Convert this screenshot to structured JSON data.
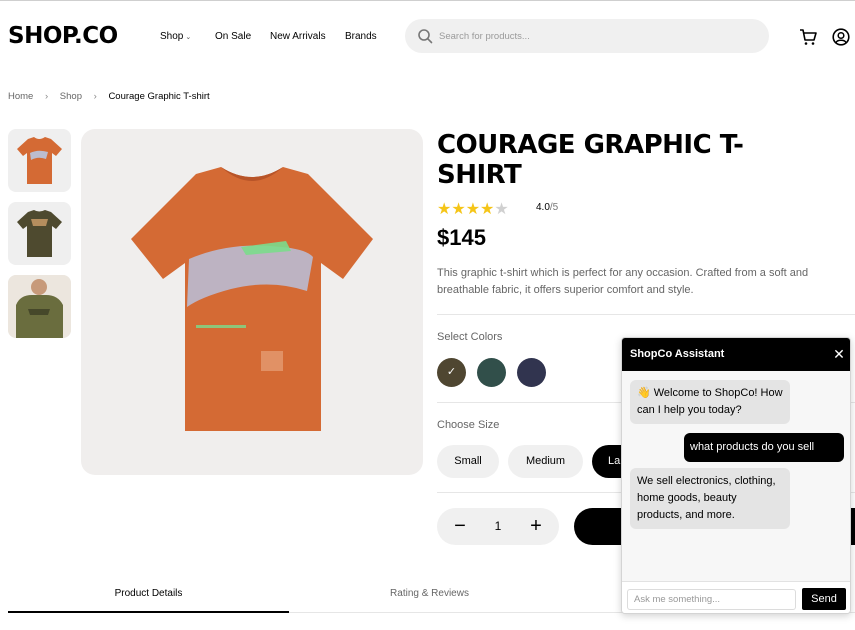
{
  "header": {
    "logo": "SHOP.CO",
    "nav": [
      "Shop",
      "On Sale",
      "New Arrivals",
      "Brands"
    ],
    "nav_dropdown_icon": "chevron-down-icon",
    "search_placeholder": "Search for products...",
    "icons": [
      "search-icon",
      "cart-icon",
      "account-icon"
    ]
  },
  "breadcrumb": [
    "Home",
    "Shop",
    "Courage Graphic T-shirt"
  ],
  "product": {
    "title": "Courage Graphic T-shirt",
    "rating": 4.0,
    "rating_text": "4.0",
    "rating_max": "/5",
    "price": "$145",
    "description": "This graphic t-shirt which is perfect for any occasion. Crafted from a soft and breathable fabric, it offers superior comfort and style.",
    "colors_label": "Select Colors",
    "colors": [
      "#4f4631",
      "#314f4a",
      "#31344f"
    ],
    "selected_color": 0,
    "size_label": "Choose Size",
    "sizes": [
      "Small",
      "Medium",
      "La"
    ],
    "selected_size": 2,
    "quantity": "1",
    "shirt_color": "#d46a34"
  },
  "tabs": [
    "Product Details",
    "Rating & Reviews"
  ],
  "chat": {
    "title": "ShopCo Assistant",
    "messages": [
      {
        "from": "bot",
        "text": "👋 Welcome to ShopCo! How can I help you today?"
      },
      {
        "from": "user",
        "text": "what products do you sell"
      },
      {
        "from": "bot",
        "text": "We sell electronics, clothing, home goods, beauty products, and more."
      }
    ],
    "input_placeholder": "Ask me something...",
    "send_label": "Send"
  }
}
